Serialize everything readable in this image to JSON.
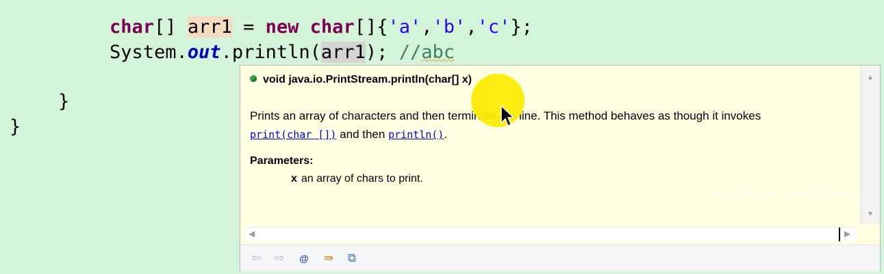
{
  "code": {
    "line1": {
      "kw1": "char",
      "brackets1": "[] ",
      "var": "arr1",
      "eq": " = ",
      "kw_new": "new",
      "sp": " ",
      "kw2": "char",
      "open": "[]{",
      "s1": "'a'",
      "c1": ",",
      "s2": "'b'",
      "c2": ",",
      "s3": "'c'",
      "close": "};"
    },
    "line2": {
      "sys": "System.",
      "out": "out",
      "println": ".println(",
      "arg": "arr1",
      "end": "); ",
      "comment_prefix": "//",
      "comment_text": "abc"
    },
    "brace_inner": "}",
    "brace_outer": "}"
  },
  "hover": {
    "signature": "void java.io.PrintStream.println(char[] x)",
    "desc_part1": "Prints an array of characters and then terminate the line. This method behaves as though it invokes",
    "link1": "print(char [])",
    "desc_and": " and then ",
    "link2": "println()",
    "desc_end": ".",
    "params_title": "Parameters:",
    "param_name": "x",
    "param_desc": "an array of chars to print."
  },
  "toolbar": {
    "back_icon": "⇦",
    "forward_icon": "⇨",
    "at_icon": "@",
    "source_icon": "⇛",
    "external_icon": "⧉"
  },
  "watermark": "https://blog.csdn.net/YENTERTAI..."
}
